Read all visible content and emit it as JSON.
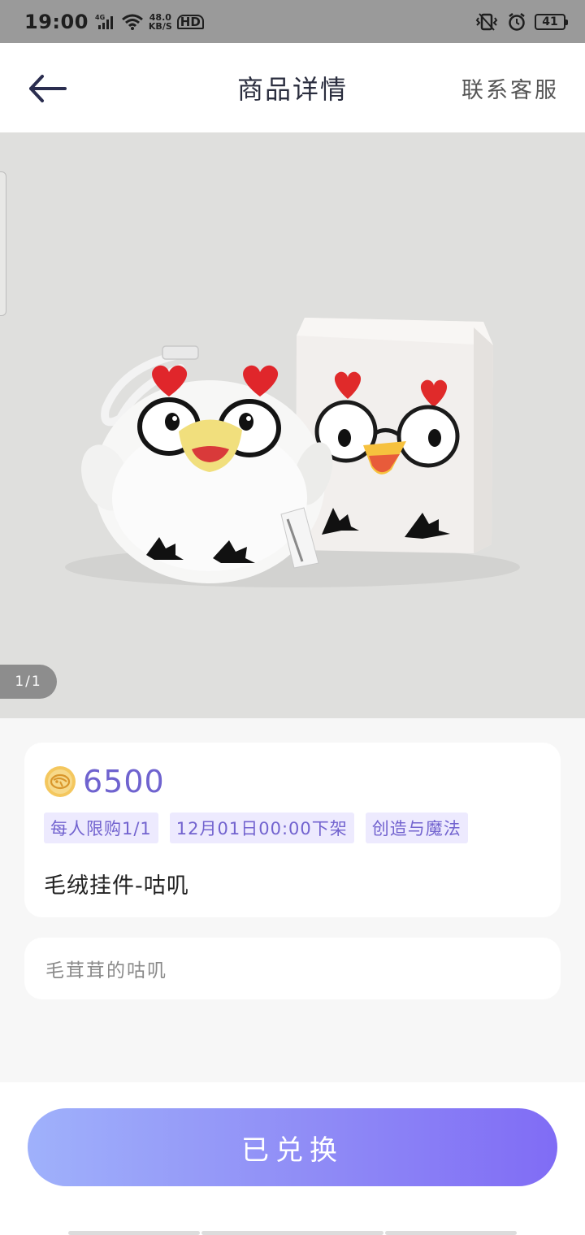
{
  "status_bar": {
    "time": "19:00",
    "network": "4G",
    "speed_value": "48.0",
    "speed_unit": "KB/S",
    "hd": "HD",
    "battery": "41"
  },
  "header": {
    "title": "商品详情",
    "contact": "联系客服"
  },
  "gallery": {
    "pager": "1/1"
  },
  "product": {
    "price": "6500",
    "tags": [
      "每人限购1/1",
      "12月01日00:00下架",
      "创造与魔法"
    ],
    "name": "毛绒挂件-咕叽",
    "description": "毛茸茸的咕叽"
  },
  "action": {
    "redeem_label": "已兑换"
  },
  "colors": {
    "accent": "#7263cf",
    "tag_bg": "#edeafe",
    "button_start": "#9fb1fb",
    "button_end": "#806cf5"
  }
}
